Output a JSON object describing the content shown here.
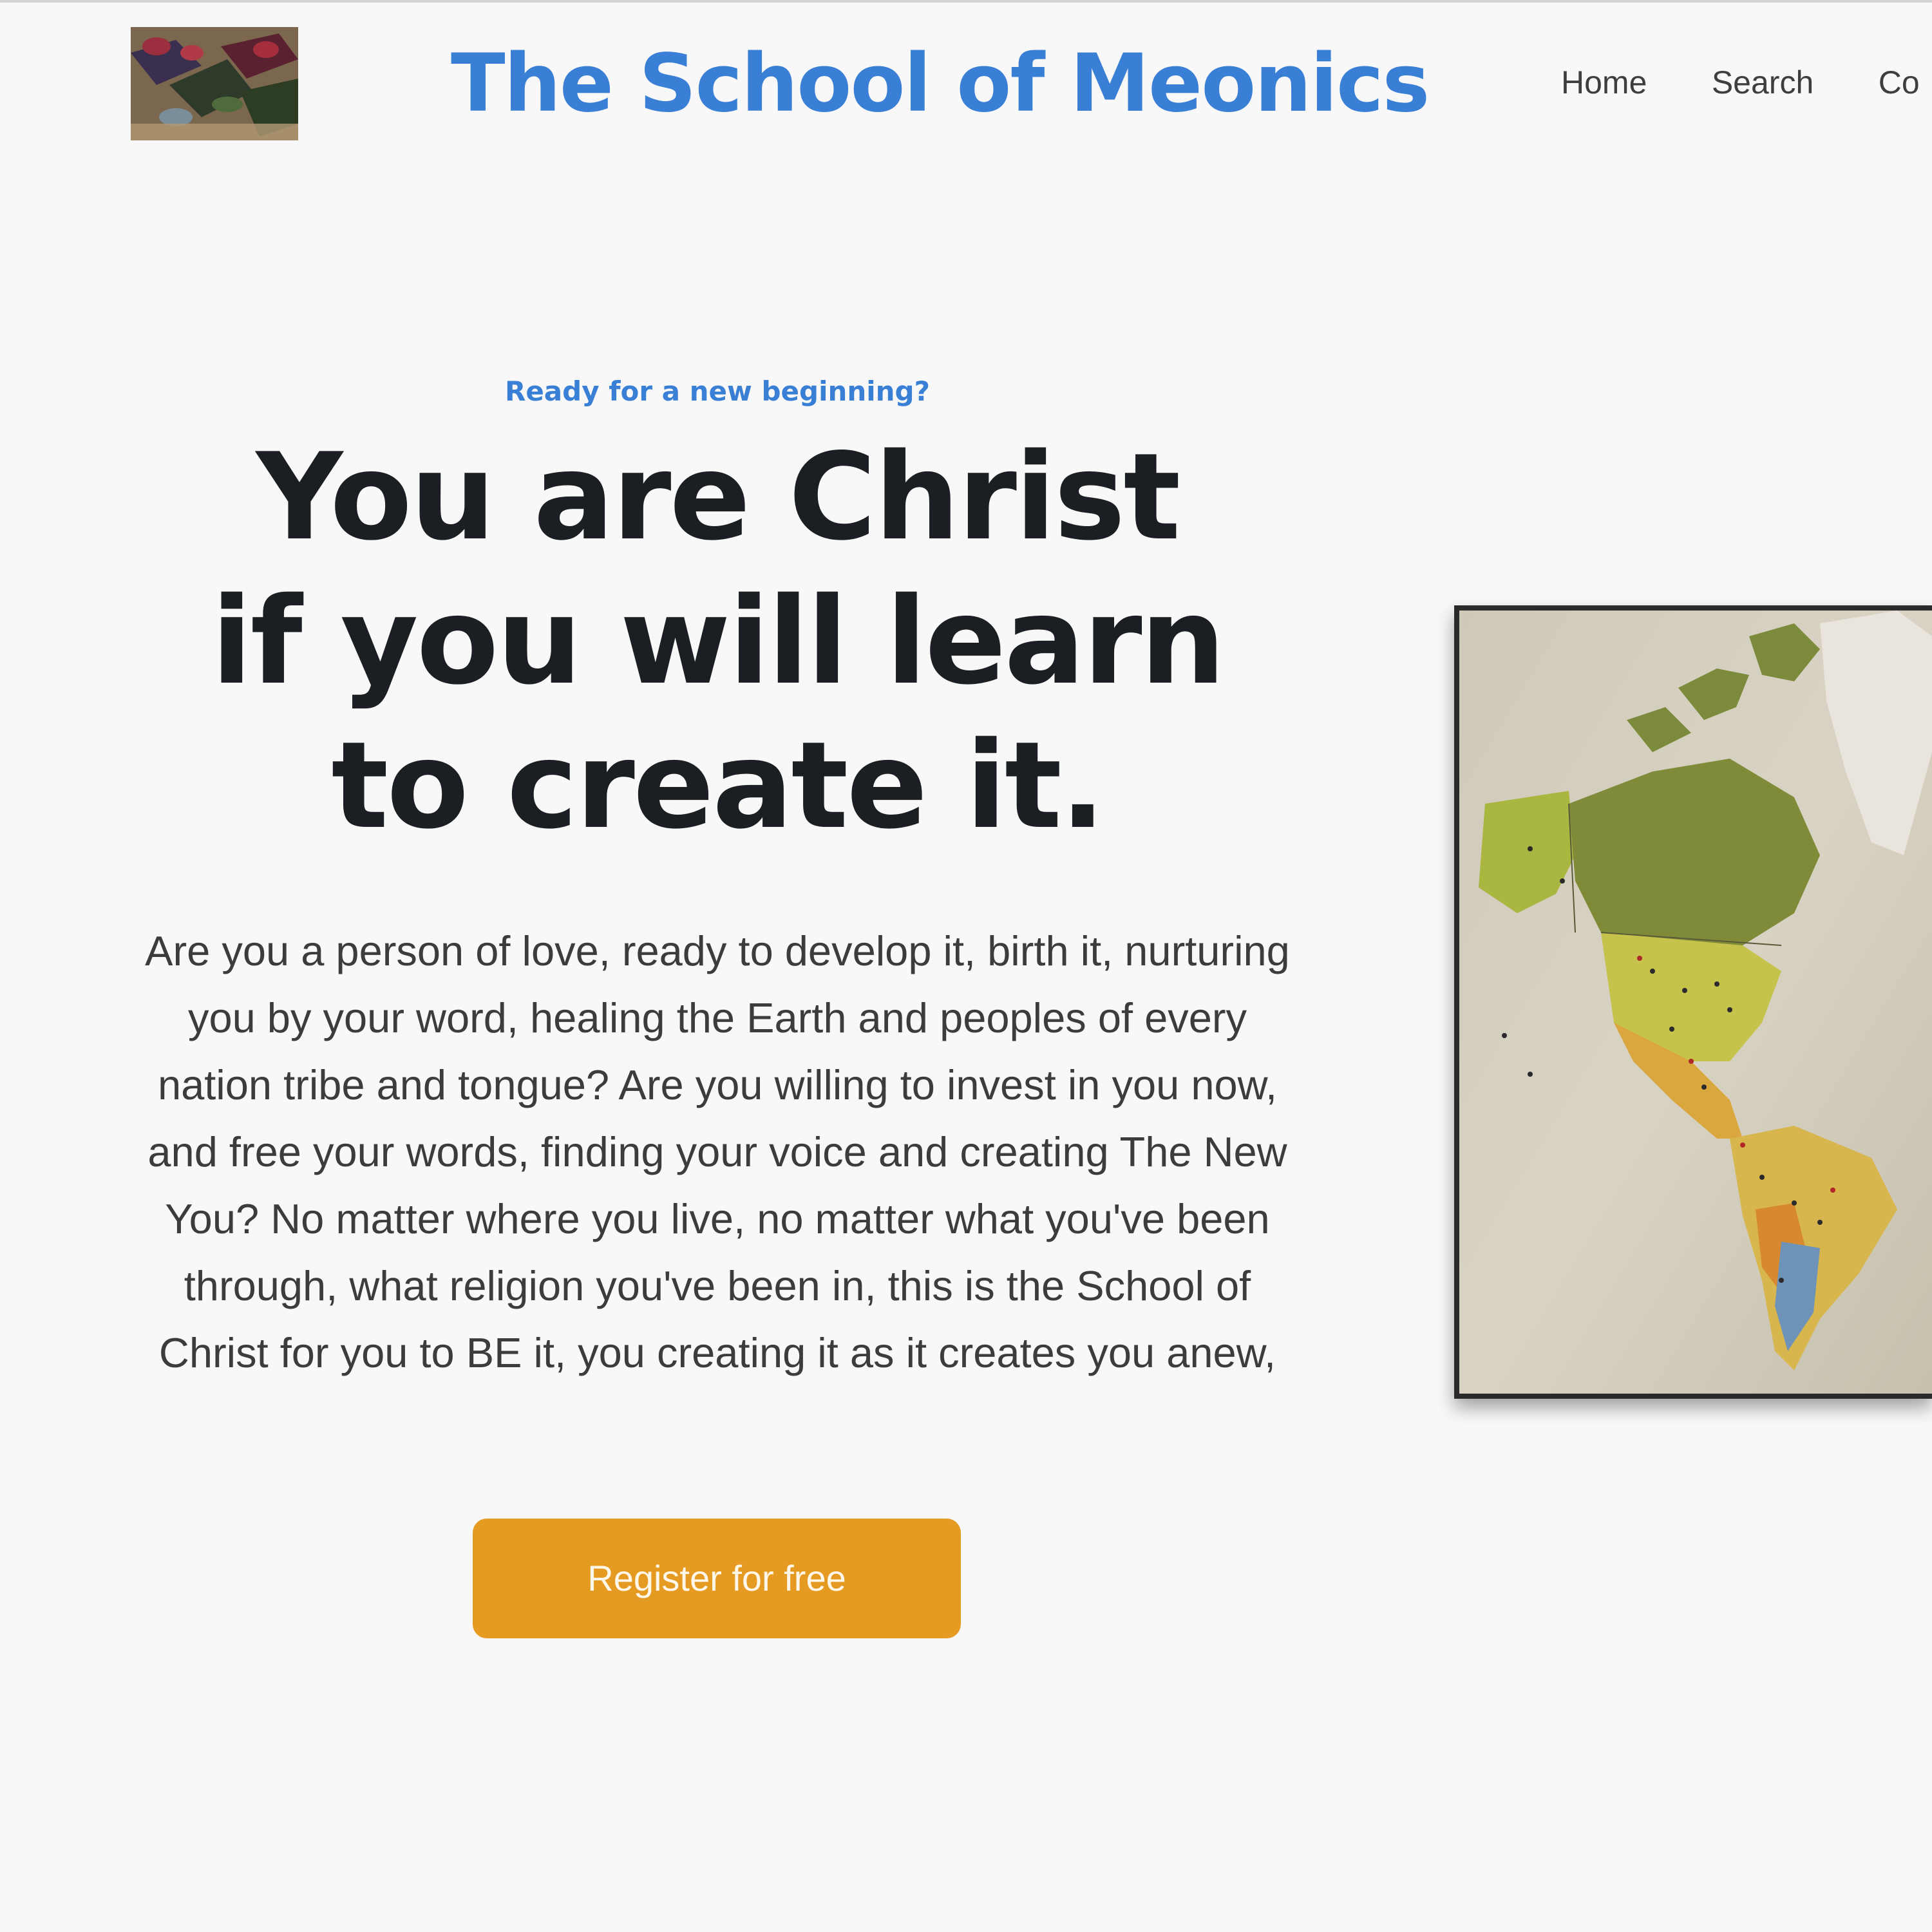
{
  "header": {
    "site_title": "The School of Meonics",
    "nav": [
      {
        "label": "Home"
      },
      {
        "label": "Search"
      },
      {
        "label": "Co"
      }
    ]
  },
  "hero": {
    "eyebrow": "Ready for a new beginning?",
    "headline": "You are Christ if you will learn to create it.",
    "body": "Are you a person of love, ready to develop it, birth it, nurturing you by your word, healing the Earth and peoples of every nation tribe and tongue? Are you willing to invest in you now, and free your words, finding your voice and creating The New You? No matter where you live, no matter what you've been through, what religion you've been in, this is the School of Christ for you to BE it, you creating it as it creates you anew,",
    "cta_label": "Register for free"
  },
  "colors": {
    "accent_blue": "#3a7fd6",
    "cta_orange": "#e59a22",
    "page_background": "#f8f8f8",
    "headline_text": "#1b1e22"
  }
}
